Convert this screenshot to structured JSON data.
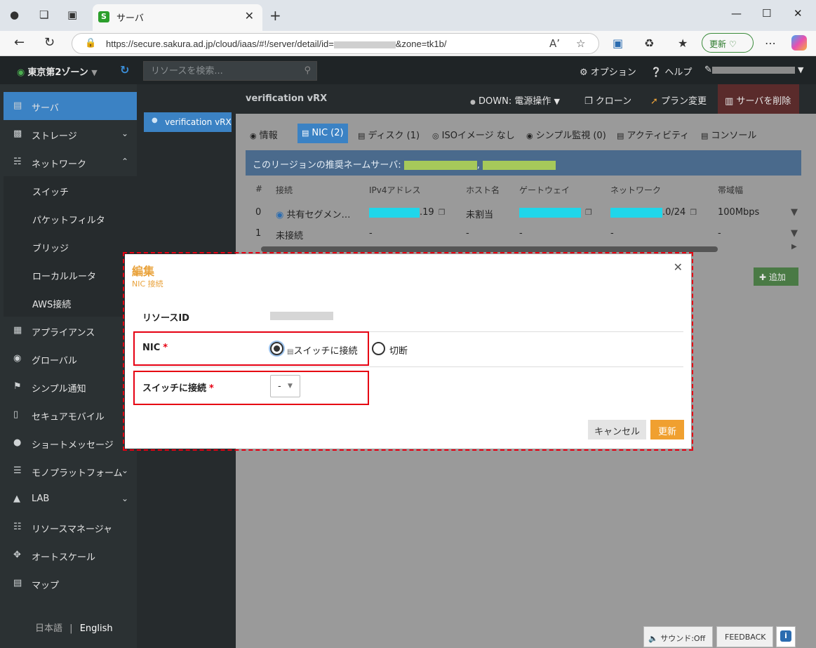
{
  "browser": {
    "tab_title": "サーバ",
    "url_prefix": "https://secure.sakura.ad.jp/cloud/iaas/#!/server/detail/id=",
    "url_suffix": "&zone=tk1b/",
    "update_label": "更新"
  },
  "header": {
    "zone": "東京第2ゾーン",
    "search_placeholder": "リソースを検索...",
    "options": "オプション",
    "help": "ヘルプ"
  },
  "sidebar": {
    "items": [
      {
        "label": "サーバ"
      },
      {
        "label": "ストレージ"
      },
      {
        "label": "ネットワーク"
      },
      {
        "label": "アプライアンス"
      },
      {
        "label": "グローバル"
      },
      {
        "label": "シンプル通知"
      },
      {
        "label": "セキュアモバイル"
      },
      {
        "label": "ショートメッセージ"
      },
      {
        "label": "モノプラットフォーム"
      },
      {
        "label": "LAB"
      },
      {
        "label": "リソースマネージャ"
      },
      {
        "label": "オートスケール"
      },
      {
        "label": "マップ"
      }
    ],
    "network_sub": [
      "スイッチ",
      "パケットフィルタ",
      "ブリッジ",
      "ローカルルータ",
      "AWS接続"
    ],
    "lang_ja": "日本語",
    "lang_sep": "|",
    "lang_en": "English"
  },
  "server_list": {
    "item": "verification vRX"
  },
  "main": {
    "title": "verification vRX",
    "status": "DOWN: 電源操作",
    "clone": "クローン",
    "plan_change": "プラン変更",
    "delete": "サーバを削除",
    "tabs": [
      "情報",
      "NIC (2)",
      "ディスク (1)",
      "ISOイメージ なし",
      "シンプル監視 (0)",
      "アクティビティ",
      "コンソール"
    ],
    "banner": "このリージョンの推奨ネームサーバ:",
    "banner_sep": ",",
    "columns": [
      "#",
      "接続",
      "IPv4アドレス",
      "ホスト名",
      "ゲートウェイ",
      "ネットワーク",
      "帯域幅"
    ],
    "rows": [
      {
        "num": "0",
        "conn": "共有セグメン…",
        "ip_suffix": ".19",
        "host": "未割当",
        "net_suffix": ".0/24",
        "bw": "100Mbps"
      },
      {
        "num": "1",
        "conn": "未接続",
        "ip": "-",
        "host": "-",
        "gw": "-",
        "net": "-",
        "bw": "-"
      }
    ],
    "add": "追加"
  },
  "bottom": {
    "sound": "サウンド:Off",
    "feedback": "FEEDBACK"
  },
  "modal": {
    "title": "編集",
    "subtitle": "NIC 接続",
    "resource_id_label": "リソースID",
    "nic_label": "NIC",
    "required_mark": "*",
    "option_switch": "スイッチに接続",
    "option_disconnect": "切断",
    "switch_label": "スイッチに接続",
    "switch_select_value": "-",
    "cancel": "キャンセル",
    "update": "更新"
  },
  "colors": {
    "accent": "#3b82c4",
    "modal_title": "#e9a23b",
    "highlight": "#e60012"
  }
}
